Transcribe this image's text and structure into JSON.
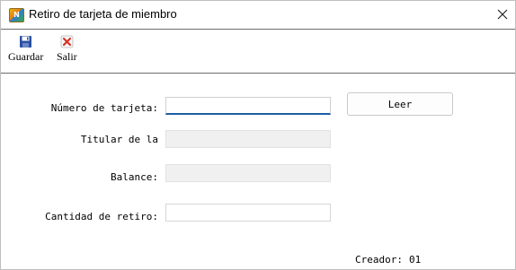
{
  "window": {
    "title": "Retiro de tarjeta de miembro",
    "app_icon_text": "N"
  },
  "toolbar": {
    "save_label": "Guardar",
    "exit_label": "Salir"
  },
  "form": {
    "card_number_label": "Número de tarjeta:",
    "card_number_value": "",
    "holder_label": "Titular de la",
    "holder_value": "",
    "balance_label": "Balance:",
    "balance_value": "",
    "withdraw_label": "Cantidad de retiro:",
    "withdraw_value": "",
    "read_button_label": "Leer"
  },
  "footer": {
    "creator_label": "Creador:",
    "creator_value": "01"
  },
  "colors": {
    "accent": "#1c5fa6",
    "save_icon": "#2a4fa0",
    "exit_icon": "#d93025"
  }
}
